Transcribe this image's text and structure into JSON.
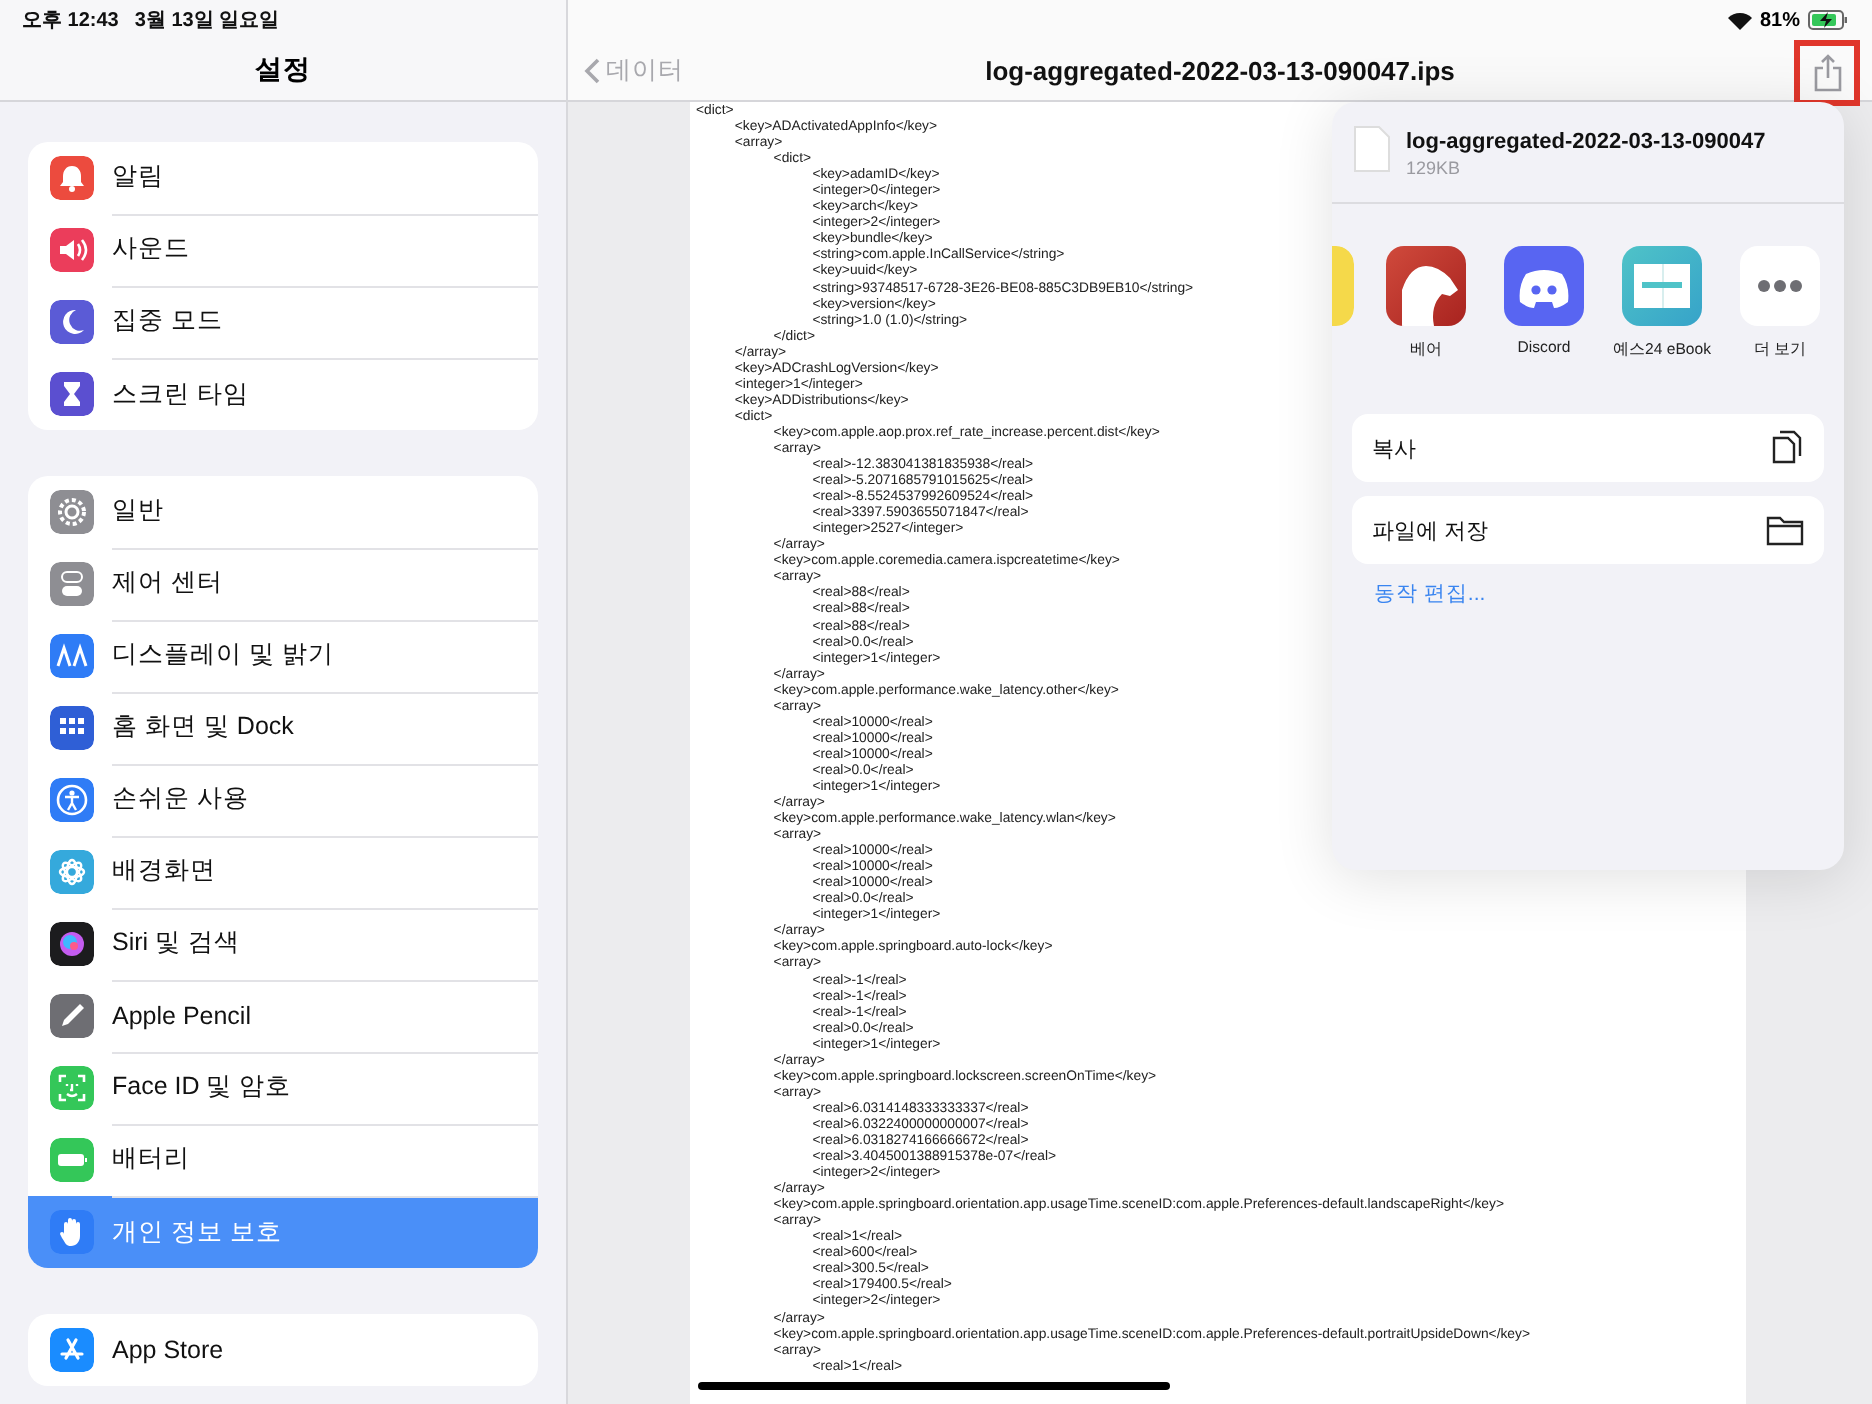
{
  "status_bar": {
    "time": "오후 12:43",
    "date": "3월 13일 일요일",
    "battery": "81%"
  },
  "sidebar": {
    "title": "설정",
    "groups": [
      {
        "items": [
          {
            "label": "알림",
            "color": "#ec4b3e",
            "selected": false
          },
          {
            "label": "사운드",
            "color": "#eb3d5b",
            "selected": false
          },
          {
            "label": "집중 모드",
            "color": "#5b5bd6",
            "selected": false
          },
          {
            "label": "스크린 타임",
            "color": "#5b4fd0",
            "selected": false
          }
        ]
      },
      {
        "items": [
          {
            "label": "일반",
            "color": "#8e8e93",
            "selected": false
          },
          {
            "label": "제어 센터",
            "color": "#8e8e93",
            "selected": false
          },
          {
            "label": "디스플레이 및 밝기",
            "color": "#2f7cf6",
            "selected": false
          },
          {
            "label": "홈 화면 및 Dock",
            "color": "#2f5fd6",
            "selected": false
          },
          {
            "label": "손쉬운 사용",
            "color": "#2f7cf6",
            "selected": false
          },
          {
            "label": "배경화면",
            "color": "#35a9dc",
            "selected": false
          },
          {
            "label": "Siri 및 검색",
            "color": "#1c1c1e",
            "selected": false
          },
          {
            "label": "Apple Pencil",
            "color": "#6e6e73",
            "selected": false
          },
          {
            "label": "Face ID 및 암호",
            "color": "#34c759",
            "selected": false
          },
          {
            "label": "배터리",
            "color": "#34c759",
            "selected": false
          },
          {
            "label": "개인 정보 보호",
            "color": "#2f7cf6",
            "selected": true
          }
        ]
      },
      {
        "items": [
          {
            "label": "App Store",
            "color": "#1a8cff",
            "selected": false
          }
        ]
      }
    ]
  },
  "viewer": {
    "back": "데이터",
    "title": "log-aggregated-2022-03-13-090047.ips",
    "share_button": {
      "highlighted": true
    },
    "lines": [
      {
        "text": "<dict>",
        "children": [
          {
            "text": "<key>ADActivatedAppInfo</key>"
          },
          {
            "text": "<array>",
            "children": [
              {
                "text": "<dict>",
                "children": [
                  {
                    "text": "<key>adamID</key>"
                  },
                  {
                    "text": "<integer>0</integer>"
                  },
                  {
                    "text": "<key>arch</key>"
                  },
                  {
                    "text": "<integer>2</integer>"
                  },
                  {
                    "text": "<key>bundle</key>"
                  },
                  {
                    "text": "<string>com.apple.InCallService</string>"
                  },
                  {
                    "text": "<key>uuid</key>"
                  },
                  {
                    "text": "<string>93748517-6728-3E26-BE08-885C3DB9EB10</string>"
                  },
                  {
                    "text": "<key>version</key>"
                  },
                  {
                    "text": "<string>1.0 (1.0)</string>"
                  }
                ]
              },
              {
                "text": "</dict>"
              }
            ]
          },
          {
            "text": "</array>"
          },
          {
            "text": "<key>ADCrashLogVersion</key>"
          },
          {
            "text": "<integer>1</integer>"
          },
          {
            "text": "<key>ADDistributions</key>"
          },
          {
            "text": "<dict>",
            "children": [
              {
                "text": "<key>com.apple.aop.prox.ref_rate_increase.percent.dist</key>"
              },
              {
                "text": "<array>",
                "children": [
                  {
                    "text": "<real>-12.383041381835938</real>"
                  },
                  {
                    "text": "<real>-5.2071685791015625</real>"
                  },
                  {
                    "text": "<real>-8.5524537992609524</real>"
                  },
                  {
                    "text": "<real>3397.5903655071847</real>"
                  },
                  {
                    "text": "<integer>2527</integer>"
                  }
                ]
              },
              {
                "text": "</array>"
              },
              {
                "text": "<key>com.apple.coremedia.camera.ispcreatetime</key>"
              },
              {
                "text": "<array>",
                "children": [
                  {
                    "text": "<real>88</real>"
                  },
                  {
                    "text": "<real>88</real>"
                  },
                  {
                    "text": "<real>88</real>"
                  },
                  {
                    "text": "<real>0.0</real>"
                  },
                  {
                    "text": "<integer>1</integer>"
                  }
                ]
              },
              {
                "text": "</array>"
              },
              {
                "text": "<key>com.apple.performance.wake_latency.other</key>"
              },
              {
                "text": "<array>",
                "children": [
                  {
                    "text": "<real>10000</real>"
                  },
                  {
                    "text": "<real>10000</real>"
                  },
                  {
                    "text": "<real>10000</real>"
                  },
                  {
                    "text": "<real>0.0</real>"
                  },
                  {
                    "text": "<integer>1</integer>"
                  }
                ]
              },
              {
                "text": "</array>"
              },
              {
                "text": "<key>com.apple.performance.wake_latency.wlan</key>"
              },
              {
                "text": "<array>",
                "children": [
                  {
                    "text": "<real>10000</real>"
                  },
                  {
                    "text": "<real>10000</real>"
                  },
                  {
                    "text": "<real>10000</real>"
                  },
                  {
                    "text": "<real>0.0</real>"
                  },
                  {
                    "text": "<integer>1</integer>"
                  }
                ]
              },
              {
                "text": "</array>"
              },
              {
                "text": "<key>com.apple.springboard.auto-lock</key>"
              },
              {
                "text": "<array>",
                "children": [
                  {
                    "text": "<real>-1</real>"
                  },
                  {
                    "text": "<real>-1</real>"
                  },
                  {
                    "text": "<real>-1</real>"
                  },
                  {
                    "text": "<real>0.0</real>"
                  },
                  {
                    "text": "<integer>1</integer>"
                  }
                ]
              },
              {
                "text": "</array>"
              },
              {
                "text": "<key>com.apple.springboard.lockscreen.screenOnTime</key>"
              },
              {
                "text": "<array>",
                "children": [
                  {
                    "text": "<real>6.0314148333333337</real>"
                  },
                  {
                    "text": "<real>6.0322400000000007</real>"
                  },
                  {
                    "text": "<real>6.0318274166666672</real>"
                  },
                  {
                    "text": "<real>3.4045001388915378e-07</real>"
                  },
                  {
                    "text": "<integer>2</integer>"
                  }
                ]
              },
              {
                "text": "</array>"
              },
              {
                "text": "<key>com.apple.springboard.orientation.app.usageTime.sceneID:com.apple.Preferences-default.landscapeRight</key>"
              },
              {
                "text": "<array>",
                "children": [
                  {
                    "text": "<real>1</real>"
                  },
                  {
                    "text": "<real>600</real>"
                  },
                  {
                    "text": "<real>300.5</real>"
                  },
                  {
                    "text": "<real>179400.5</real>"
                  },
                  {
                    "text": "<integer>2</integer>"
                  }
                ]
              },
              {
                "text": "</array>"
              },
              {
                "text": "<key>com.apple.springboard.orientation.app.usageTime.sceneID:com.apple.Preferences-default.portraitUpsideDown</key>"
              },
              {
                "text": "<array>",
                "children": [
                  {
                    "text": "<real>1</real>"
                  }
                ]
              }
            ]
          }
        ]
      }
    ]
  },
  "share_sheet": {
    "file_name": "log-aggregated-2022-03-13-090047",
    "file_size": "129KB",
    "apps": [
      "베어",
      "Discord",
      "예스24 eBook",
      "더 보기"
    ],
    "actions": [
      {
        "label": "복사"
      },
      {
        "label": "파일에 저장"
      }
    ],
    "edit_link": "동작 편집..."
  }
}
